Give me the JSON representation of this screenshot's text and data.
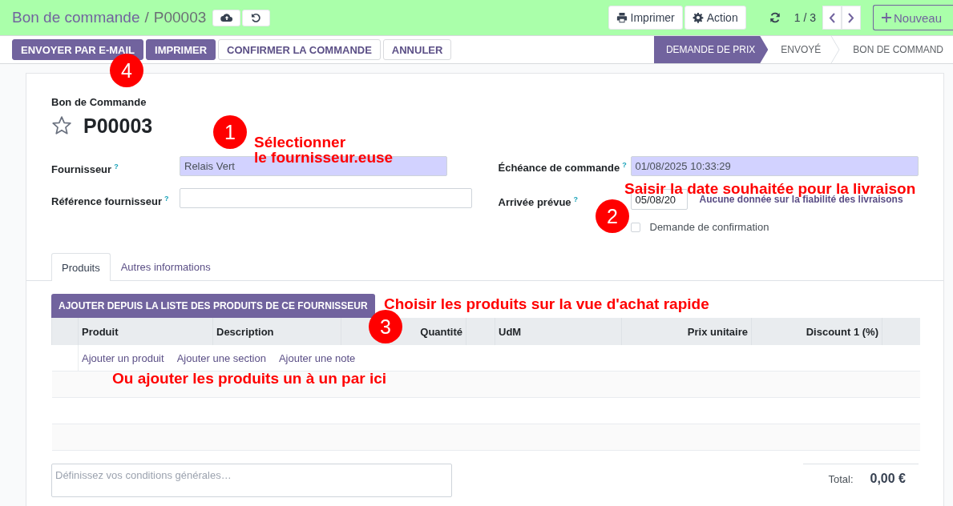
{
  "control_bar": {
    "breadcrumb": {
      "parent": "Bon de commande",
      "separator": "/",
      "current": "P00003"
    },
    "actions": [
      {
        "label": "Imprimer",
        "kind": "print"
      },
      {
        "label": "Action",
        "kind": "gear"
      }
    ],
    "pager": "1 / 3",
    "new_button": "Nouveau"
  },
  "action_bar": {
    "buttons": [
      {
        "label": "ENVOYER PAR E-MAIL",
        "kind": "primary"
      },
      {
        "label": "IMPRIMER",
        "kind": "primary"
      },
      {
        "label": "CONFIRMER LA COMMANDE",
        "kind": "secondary"
      },
      {
        "label": "ANNULER",
        "kind": "secondary"
      }
    ],
    "statusbar": [
      {
        "label": "DEMANDE DE PRIX",
        "selected": true
      },
      {
        "label": "ENVOYÉ",
        "selected": false
      },
      {
        "label": "BON DE COMMAND",
        "selected": false
      }
    ]
  },
  "form": {
    "caption": "Bon de Commande",
    "name": "P00003",
    "starred": false,
    "left_fields": [
      {
        "label": "Fournisseur",
        "help": "?",
        "value": "Relais Vert",
        "required": true
      },
      {
        "label": "Référence fournisseur",
        "help": "?",
        "required": false
      }
    ],
    "deadline": {
      "label": "Échéance de commande",
      "help": "?",
      "value": "01/08/2025 10:33:29",
      "required": true
    },
    "arrival": {
      "label": "Arrivée prévue",
      "help": "?",
      "value": "05/08/20",
      "note": "Aucune donnée sur la fiabilité des livraisons"
    },
    "confirmation": {
      "label": "Demande de confirmation",
      "checked": false
    },
    "tabs": [
      {
        "label": "Produits",
        "selected": true
      },
      {
        "label": "Autres informations",
        "selected": false
      }
    ],
    "supplier_products_button": "AJOUTER DEPUIS LA LISTE DES PRODUITS DE CE FOURNISSEUR",
    "columns": [
      {
        "label": "Produit",
        "kind": "text"
      },
      {
        "label": "Description",
        "kind": "text"
      },
      {
        "label": "Quantité",
        "kind": "number"
      },
      {
        "label": "UdM",
        "kind": "text"
      },
      {
        "label": "Prix unitaire",
        "kind": "number"
      },
      {
        "label": "Discount 1 (%)",
        "kind": "number"
      }
    ],
    "add_links": [
      "Ajouter un produit",
      "Ajouter une section",
      "Ajouter une note"
    ],
    "terms": {
      "placeholder": "Définissez vos conditions générales…"
    },
    "total": {
      "label": "Total:",
      "value": "0,00 €"
    }
  },
  "annotations": [
    {
      "number": "1",
      "text": "Sélectionner\nle fournisseur.euse"
    },
    {
      "number": "2",
      "text": "Saisir la date souhaitée pour la livraison"
    },
    {
      "number": "3",
      "text": "Choisir les produits sur la vue d'achat rapide"
    },
    {
      "text": "Ou ajouter les produits un à un par ici"
    },
    {
      "number": "4"
    }
  ]
}
